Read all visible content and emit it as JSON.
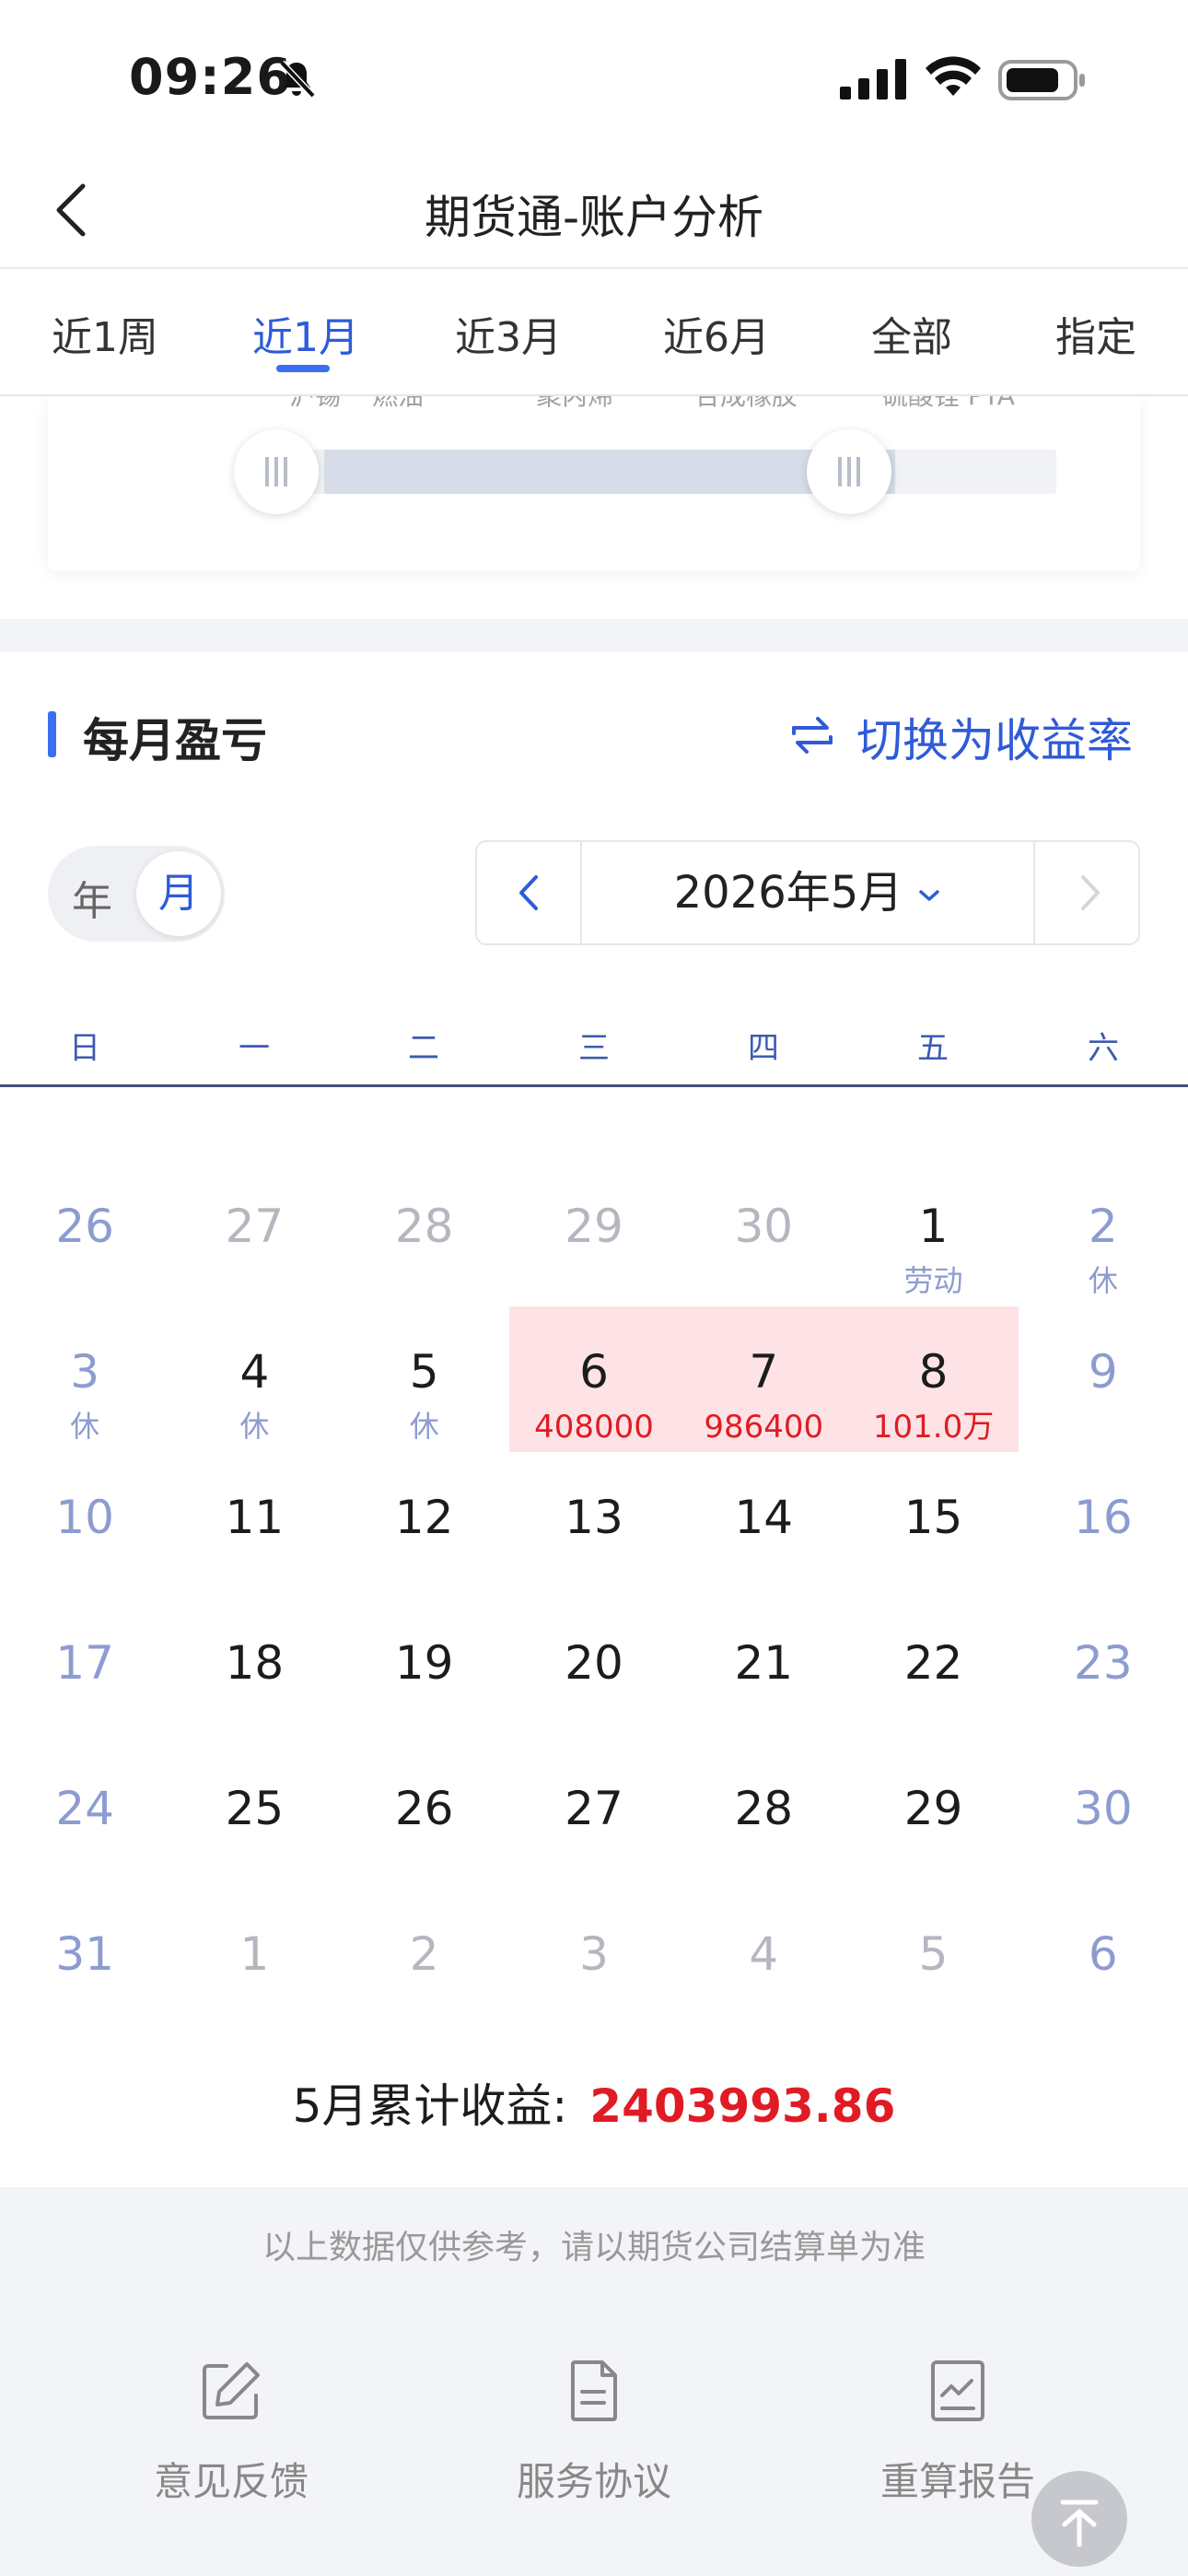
{
  "status_bar": {
    "time": "09:26"
  },
  "nav": {
    "title": "期货通-账户分析"
  },
  "tabs": [
    {
      "label": "近1周"
    },
    {
      "label": "近1月"
    },
    {
      "label": "近3月"
    },
    {
      "label": "近6月"
    },
    {
      "label": "全部"
    },
    {
      "label": "指定"
    }
  ],
  "active_tab": "近1月",
  "slider": {
    "labels": [
      "沪锡",
      "燃油",
      "聚丙烯",
      "合成橡胶",
      "硫酸锂 PTA"
    ]
  },
  "section": {
    "title": "每月盈亏",
    "switch_label": "切换为收益率"
  },
  "toggle": {
    "year": "年",
    "month": "月"
  },
  "month_picker": {
    "label": "2026年5月"
  },
  "weekdays": [
    "日",
    "一",
    "二",
    "三",
    "四",
    "五",
    "六"
  ],
  "calendar": {
    "weeks": [
      [
        {
          "d": "26",
          "t": "other-weekend"
        },
        {
          "d": "27",
          "t": "other"
        },
        {
          "d": "28",
          "t": "other"
        },
        {
          "d": "29",
          "t": "other"
        },
        {
          "d": "30",
          "t": "other"
        },
        {
          "d": "1",
          "t": "normal",
          "sub": "劳动",
          "st": "holiday"
        },
        {
          "d": "2",
          "t": "weekend",
          "sub": "休",
          "st": "holiday"
        }
      ],
      [
        {
          "d": "3",
          "t": "weekend",
          "sub": "休",
          "st": "holiday"
        },
        {
          "d": "4",
          "t": "normal",
          "sub": "休",
          "st": "holiday"
        },
        {
          "d": "5",
          "t": "normal",
          "sub": "休",
          "st": "holiday"
        },
        {
          "d": "6",
          "t": "normal",
          "sub": "408000",
          "st": "profit"
        },
        {
          "d": "7",
          "t": "normal",
          "sub": "986400",
          "st": "profit"
        },
        {
          "d": "8",
          "t": "normal",
          "sub": "101.0万",
          "st": "profit"
        },
        {
          "d": "9",
          "t": "weekend"
        }
      ],
      [
        {
          "d": "10",
          "t": "weekend"
        },
        {
          "d": "11",
          "t": "normal"
        },
        {
          "d": "12",
          "t": "normal"
        },
        {
          "d": "13",
          "t": "normal"
        },
        {
          "d": "14",
          "t": "normal"
        },
        {
          "d": "15",
          "t": "normal"
        },
        {
          "d": "16",
          "t": "weekend"
        }
      ],
      [
        {
          "d": "17",
          "t": "weekend"
        },
        {
          "d": "18",
          "t": "normal"
        },
        {
          "d": "19",
          "t": "normal"
        },
        {
          "d": "20",
          "t": "normal"
        },
        {
          "d": "21",
          "t": "normal"
        },
        {
          "d": "22",
          "t": "normal"
        },
        {
          "d": "23",
          "t": "weekend"
        }
      ],
      [
        {
          "d": "24",
          "t": "weekend"
        },
        {
          "d": "25",
          "t": "normal"
        },
        {
          "d": "26",
          "t": "normal"
        },
        {
          "d": "27",
          "t": "normal"
        },
        {
          "d": "28",
          "t": "normal"
        },
        {
          "d": "29",
          "t": "normal"
        },
        {
          "d": "30",
          "t": "weekend"
        }
      ],
      [
        {
          "d": "31",
          "t": "weekend"
        },
        {
          "d": "1",
          "t": "other"
        },
        {
          "d": "2",
          "t": "other"
        },
        {
          "d": "3",
          "t": "other"
        },
        {
          "d": "4",
          "t": "other"
        },
        {
          "d": "5",
          "t": "other"
        },
        {
          "d": "6",
          "t": "other-weekend"
        }
      ]
    ]
  },
  "summary": {
    "label": "5月累计收益:",
    "value": "2403993.86"
  },
  "footer": {
    "disclaimer": "以上数据仅供参考，请以期货公司结算单为准",
    "items": [
      {
        "label": "意见反馈",
        "icon": "edit-icon"
      },
      {
        "label": "服务协议",
        "icon": "document-icon"
      },
      {
        "label": "重算报告",
        "icon": "chart-report-icon"
      }
    ]
  },
  "colors": {
    "accent": "#2e5bd8",
    "profit": "#e01b24",
    "highlight": "#fde3e5",
    "weekend": "#8d9cd0"
  }
}
